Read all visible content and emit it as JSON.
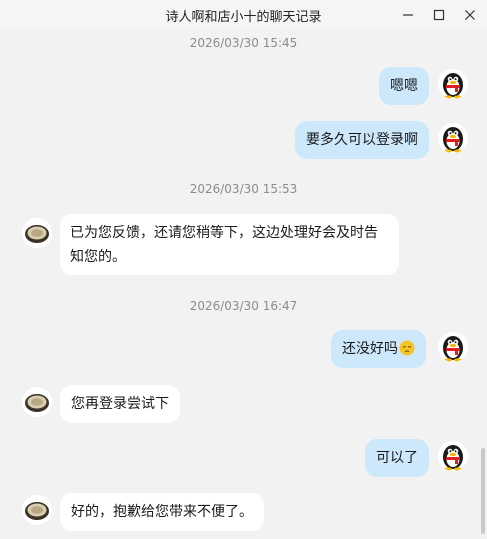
{
  "window": {
    "title": "诗人啊和店小十的聊天记录",
    "minimize_icon": "minimize-icon",
    "maximize_icon": "maximize-icon",
    "close_icon": "close-icon"
  },
  "messages": [
    {
      "type": "timestamp",
      "text": "2026/03/30 15:45"
    },
    {
      "type": "outgoing",
      "text": "嗯嗯",
      "avatar": "penguin-avatar"
    },
    {
      "type": "outgoing",
      "text": "要多久可以登录啊",
      "avatar": "penguin-avatar"
    },
    {
      "type": "timestamp",
      "text": "2026/03/30 15:53"
    },
    {
      "type": "incoming",
      "text": "已为您反馈，还请您稍等下，这边处理好会及时告知您的。",
      "avatar": "bowl-avatar"
    },
    {
      "type": "timestamp",
      "text": "2026/03/30 16:47"
    },
    {
      "type": "outgoing",
      "text": "还没好吗",
      "emoji": "pensive-face-emoji",
      "avatar": "penguin-avatar"
    },
    {
      "type": "incoming",
      "text": "您再登录尝试下",
      "avatar": "bowl-avatar"
    },
    {
      "type": "outgoing",
      "text": "可以了",
      "avatar": "penguin-avatar"
    },
    {
      "type": "incoming",
      "text": "好的，抱歉给您带来不便了。",
      "avatar": "bowl-avatar"
    }
  ],
  "colors": {
    "outgoing_bubble": "#cde7fb",
    "incoming_bubble": "#ffffff",
    "background": "#f2f2f2",
    "timestamp_text": "#8c8c8c"
  }
}
